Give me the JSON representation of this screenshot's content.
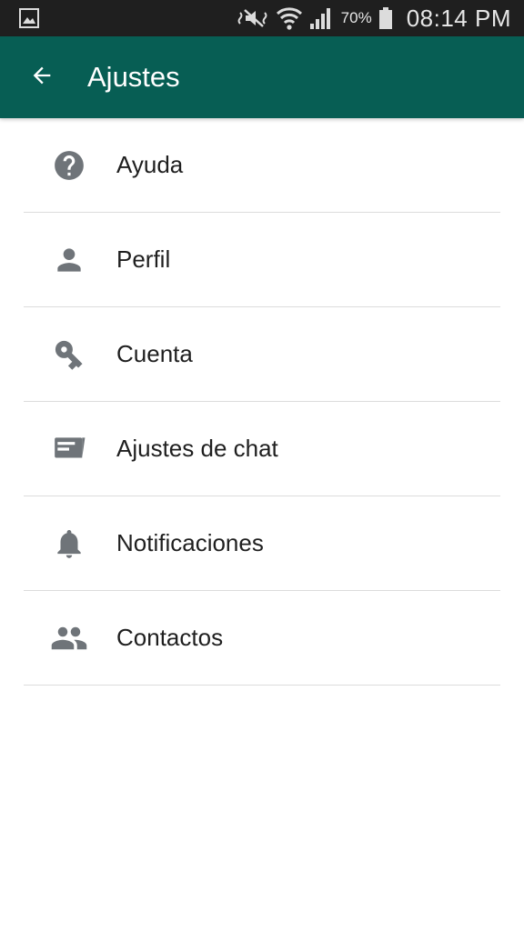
{
  "status_bar": {
    "icons": [
      "gallery-icon",
      "mute-icon",
      "wifi-icon",
      "signal-icon",
      "battery-icon"
    ],
    "battery": "70%",
    "time": "08:14 PM"
  },
  "app_bar": {
    "back_icon": "arrow-back-icon",
    "title": "Ajustes",
    "color": "#075e54"
  },
  "settings": {
    "icon_color": "#6f7479",
    "items": [
      {
        "label": "Ayuda",
        "icon": "help-icon"
      },
      {
        "label": "Perfil",
        "icon": "person-icon"
      },
      {
        "label": "Cuenta",
        "icon": "key-icon"
      },
      {
        "label": "Ajustes de chat",
        "icon": "chat-icon"
      },
      {
        "label": "Notificaciones",
        "icon": "bell-icon"
      },
      {
        "label": "Contactos",
        "icon": "contacts-icon"
      }
    ]
  }
}
